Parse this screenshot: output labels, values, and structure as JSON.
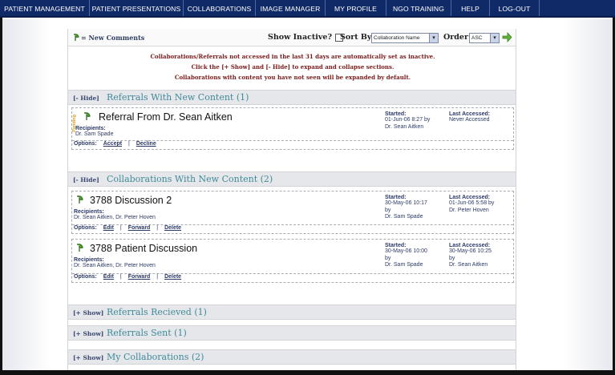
{
  "nav": [
    {
      "label": "PATIENT MANAGEMENT"
    },
    {
      "label": "PATIENT PRESENTATIONS"
    },
    {
      "label": "COLLABORATIONS"
    },
    {
      "label": "IMAGE MANAGER"
    },
    {
      "label": "MY PROFILE"
    },
    {
      "label": "NGO TRAINING"
    },
    {
      "label": "HELP"
    },
    {
      "label": "LOG-OUT"
    }
  ],
  "toolbar": {
    "new_comments": "= New Comments",
    "show_inactive_label": "Show Inactive?",
    "sort_by_label": "Sort By:",
    "sort_by_value": "Collaboration Name",
    "order_label": "Order:",
    "order_value": "ASC"
  },
  "notice": [
    "Collaborations/Referrals not accessed in the last 31 days are automatically set as inactive.",
    "Click the [+ Show] and [- Hide] to expand and collapse sections.",
    "Collaborations with content you have not seen will be expanded by default."
  ],
  "sections": [
    {
      "toggle": "[- Hide]",
      "title": "Referrals With New Content (1)"
    },
    {
      "toggle": "[- Hide]",
      "title": "Collaborations With New Content (2)"
    },
    {
      "toggle": "[+ Show]",
      "title": "Referrals Recieved (1)"
    },
    {
      "toggle": "[+ Show]",
      "title": "Referrals Sent (1)"
    },
    {
      "toggle": "[+ Show]",
      "title": "My Collaborations (2)"
    }
  ],
  "items": [
    {
      "title": "Referral From Dr. Sean Aitken",
      "pending_badge": "Pending",
      "recipients_label": "Recipients:",
      "recipients": "Dr. Sam Spade",
      "started_label": "Started:",
      "started_line1": "01-Jun-06 8:27 by",
      "started_line2": "Dr. Sean Aitken",
      "accessed_label": "Last Accessed:",
      "accessed_line1": "Never Accessed",
      "accessed_line2": "",
      "options_label": "Options:",
      "actions": [
        "Accept",
        "Decline"
      ]
    },
    {
      "title": "3788 Discussion 2",
      "recipients_label": "Recipients:",
      "recipients": "Dr. Sean Aitken, Dr. Peter Hoven",
      "started_label": "Started:",
      "started_line1": "30-May-06 10:17",
      "started_line2": "by",
      "started_line3": "Dr. Sam Spade",
      "accessed_label": "Last Accessed:",
      "accessed_line1": "01-Jun-06 5:58 by",
      "accessed_line2": "Dr. Peter Hoven",
      "options_label": "Options:",
      "actions": [
        "Edit",
        "Forward",
        "Delete"
      ]
    },
    {
      "title": "3788 Patient Discussion",
      "recipients_label": "Recipients:",
      "recipients": "Dr. Sean Aitken, Dr. Peter Hoven",
      "started_label": "Started:",
      "started_line1": "30-May-06 10:00",
      "started_line2": "by",
      "started_line3": "Dr. Sam Spade",
      "accessed_label": "Last Accessed:",
      "accessed_line1": "30-May-06 10:25",
      "accessed_line2": "by",
      "accessed_line3": "Dr. Sean Aitken",
      "options_label": "Options:",
      "actions": [
        "Edit",
        "Forward",
        "Delete"
      ]
    }
  ],
  "colors": {
    "nav_bg": "#0f2a66",
    "section_title": "#3f8a9a",
    "notice": "#7a1a1a",
    "pending": "#d89b1a"
  }
}
